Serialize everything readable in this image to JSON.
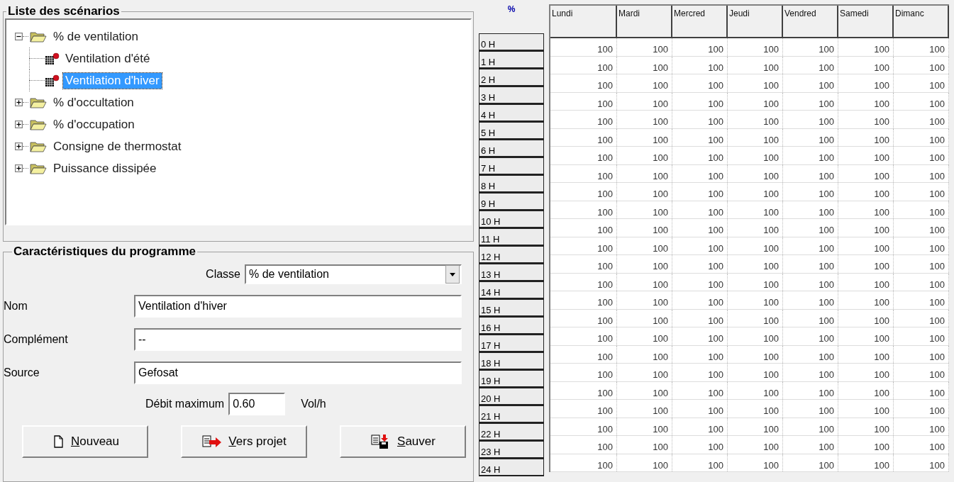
{
  "scenarios": {
    "title": "Liste des scénarios",
    "tree": [
      {
        "label": "% de ventilation",
        "expanded": true,
        "selected": false,
        "children": [
          {
            "label": "Ventilation d'été",
            "selected": false
          },
          {
            "label": "Ventilation d'hiver",
            "selected": true
          }
        ]
      },
      {
        "label": "% d'occultation",
        "expanded": false,
        "selected": false
      },
      {
        "label": "% d'occupation",
        "expanded": false,
        "selected": false
      },
      {
        "label": "Consigne de thermostat",
        "expanded": false,
        "selected": false
      },
      {
        "label": "Puissance dissipée",
        "expanded": false,
        "selected": false
      }
    ]
  },
  "program": {
    "title": "Caractéristiques du programme",
    "classe": {
      "label": "Classe",
      "value": "% de ventilation"
    },
    "fields": [
      {
        "label": "Nom",
        "value": "Ventilation d'hiver"
      },
      {
        "label": "Complément",
        "value": "--"
      },
      {
        "label": "Source",
        "value": "Gefosat"
      }
    ],
    "debit": {
      "label": "Débit maximum",
      "value": "0.60",
      "unit": "Vol/h"
    },
    "buttons": [
      {
        "kind": "new",
        "label": "Nouveau",
        "first_letter_underlined": true
      },
      {
        "kind": "export",
        "label": "Vers projet",
        "first_letter_underlined": true
      },
      {
        "kind": "save",
        "label": "Sauver",
        "first_letter_underlined": true
      }
    ]
  },
  "hours": {
    "header": "%",
    "labels": [
      "0 H",
      "1 H",
      "2 H",
      "3 H",
      "4 H",
      "5 H",
      "6 H",
      "7 H",
      "8 H",
      "9 H",
      "10 H",
      "11 H",
      "12 H",
      "13 H",
      "14 H",
      "15 H",
      "16 H",
      "17 H",
      "18 H",
      "19 H",
      "20 H",
      "21 H",
      "22 H",
      "23 H",
      "24 H"
    ]
  },
  "table": {
    "columns": [
      "Lundi",
      "Mardi",
      "Mercred",
      "Jeudi",
      "Vendred",
      "Samedi",
      "Dimanc"
    ],
    "rows": [
      [
        "100",
        "100",
        "100",
        "100",
        "100",
        "100",
        "100"
      ],
      [
        "100",
        "100",
        "100",
        "100",
        "100",
        "100",
        "100"
      ],
      [
        "100",
        "100",
        "100",
        "100",
        "100",
        "100",
        "100"
      ],
      [
        "100",
        "100",
        "100",
        "100",
        "100",
        "100",
        "100"
      ],
      [
        "100",
        "100",
        "100",
        "100",
        "100",
        "100",
        "100"
      ],
      [
        "100",
        "100",
        "100",
        "100",
        "100",
        "100",
        "100"
      ],
      [
        "100",
        "100",
        "100",
        "100",
        "100",
        "100",
        "100"
      ],
      [
        "100",
        "100",
        "100",
        "100",
        "100",
        "100",
        "100"
      ],
      [
        "100",
        "100",
        "100",
        "100",
        "100",
        "100",
        "100"
      ],
      [
        "100",
        "100",
        "100",
        "100",
        "100",
        "100",
        "100"
      ],
      [
        "100",
        "100",
        "100",
        "100",
        "100",
        "100",
        "100"
      ],
      [
        "100",
        "100",
        "100",
        "100",
        "100",
        "100",
        "100"
      ],
      [
        "100",
        "100",
        "100",
        "100",
        "100",
        "100",
        "100"
      ],
      [
        "100",
        "100",
        "100",
        "100",
        "100",
        "100",
        "100"
      ],
      [
        "100",
        "100",
        "100",
        "100",
        "100",
        "100",
        "100"
      ],
      [
        "100",
        "100",
        "100",
        "100",
        "100",
        "100",
        "100"
      ],
      [
        "100",
        "100",
        "100",
        "100",
        "100",
        "100",
        "100"
      ],
      [
        "100",
        "100",
        "100",
        "100",
        "100",
        "100",
        "100"
      ],
      [
        "100",
        "100",
        "100",
        "100",
        "100",
        "100",
        "100"
      ],
      [
        "100",
        "100",
        "100",
        "100",
        "100",
        "100",
        "100"
      ],
      [
        "100",
        "100",
        "100",
        "100",
        "100",
        "100",
        "100"
      ],
      [
        "100",
        "100",
        "100",
        "100",
        "100",
        "100",
        "100"
      ],
      [
        "100",
        "100",
        "100",
        "100",
        "100",
        "100",
        "100"
      ],
      [
        "100",
        "100",
        "100",
        "100",
        "100",
        "100",
        "100"
      ]
    ]
  }
}
